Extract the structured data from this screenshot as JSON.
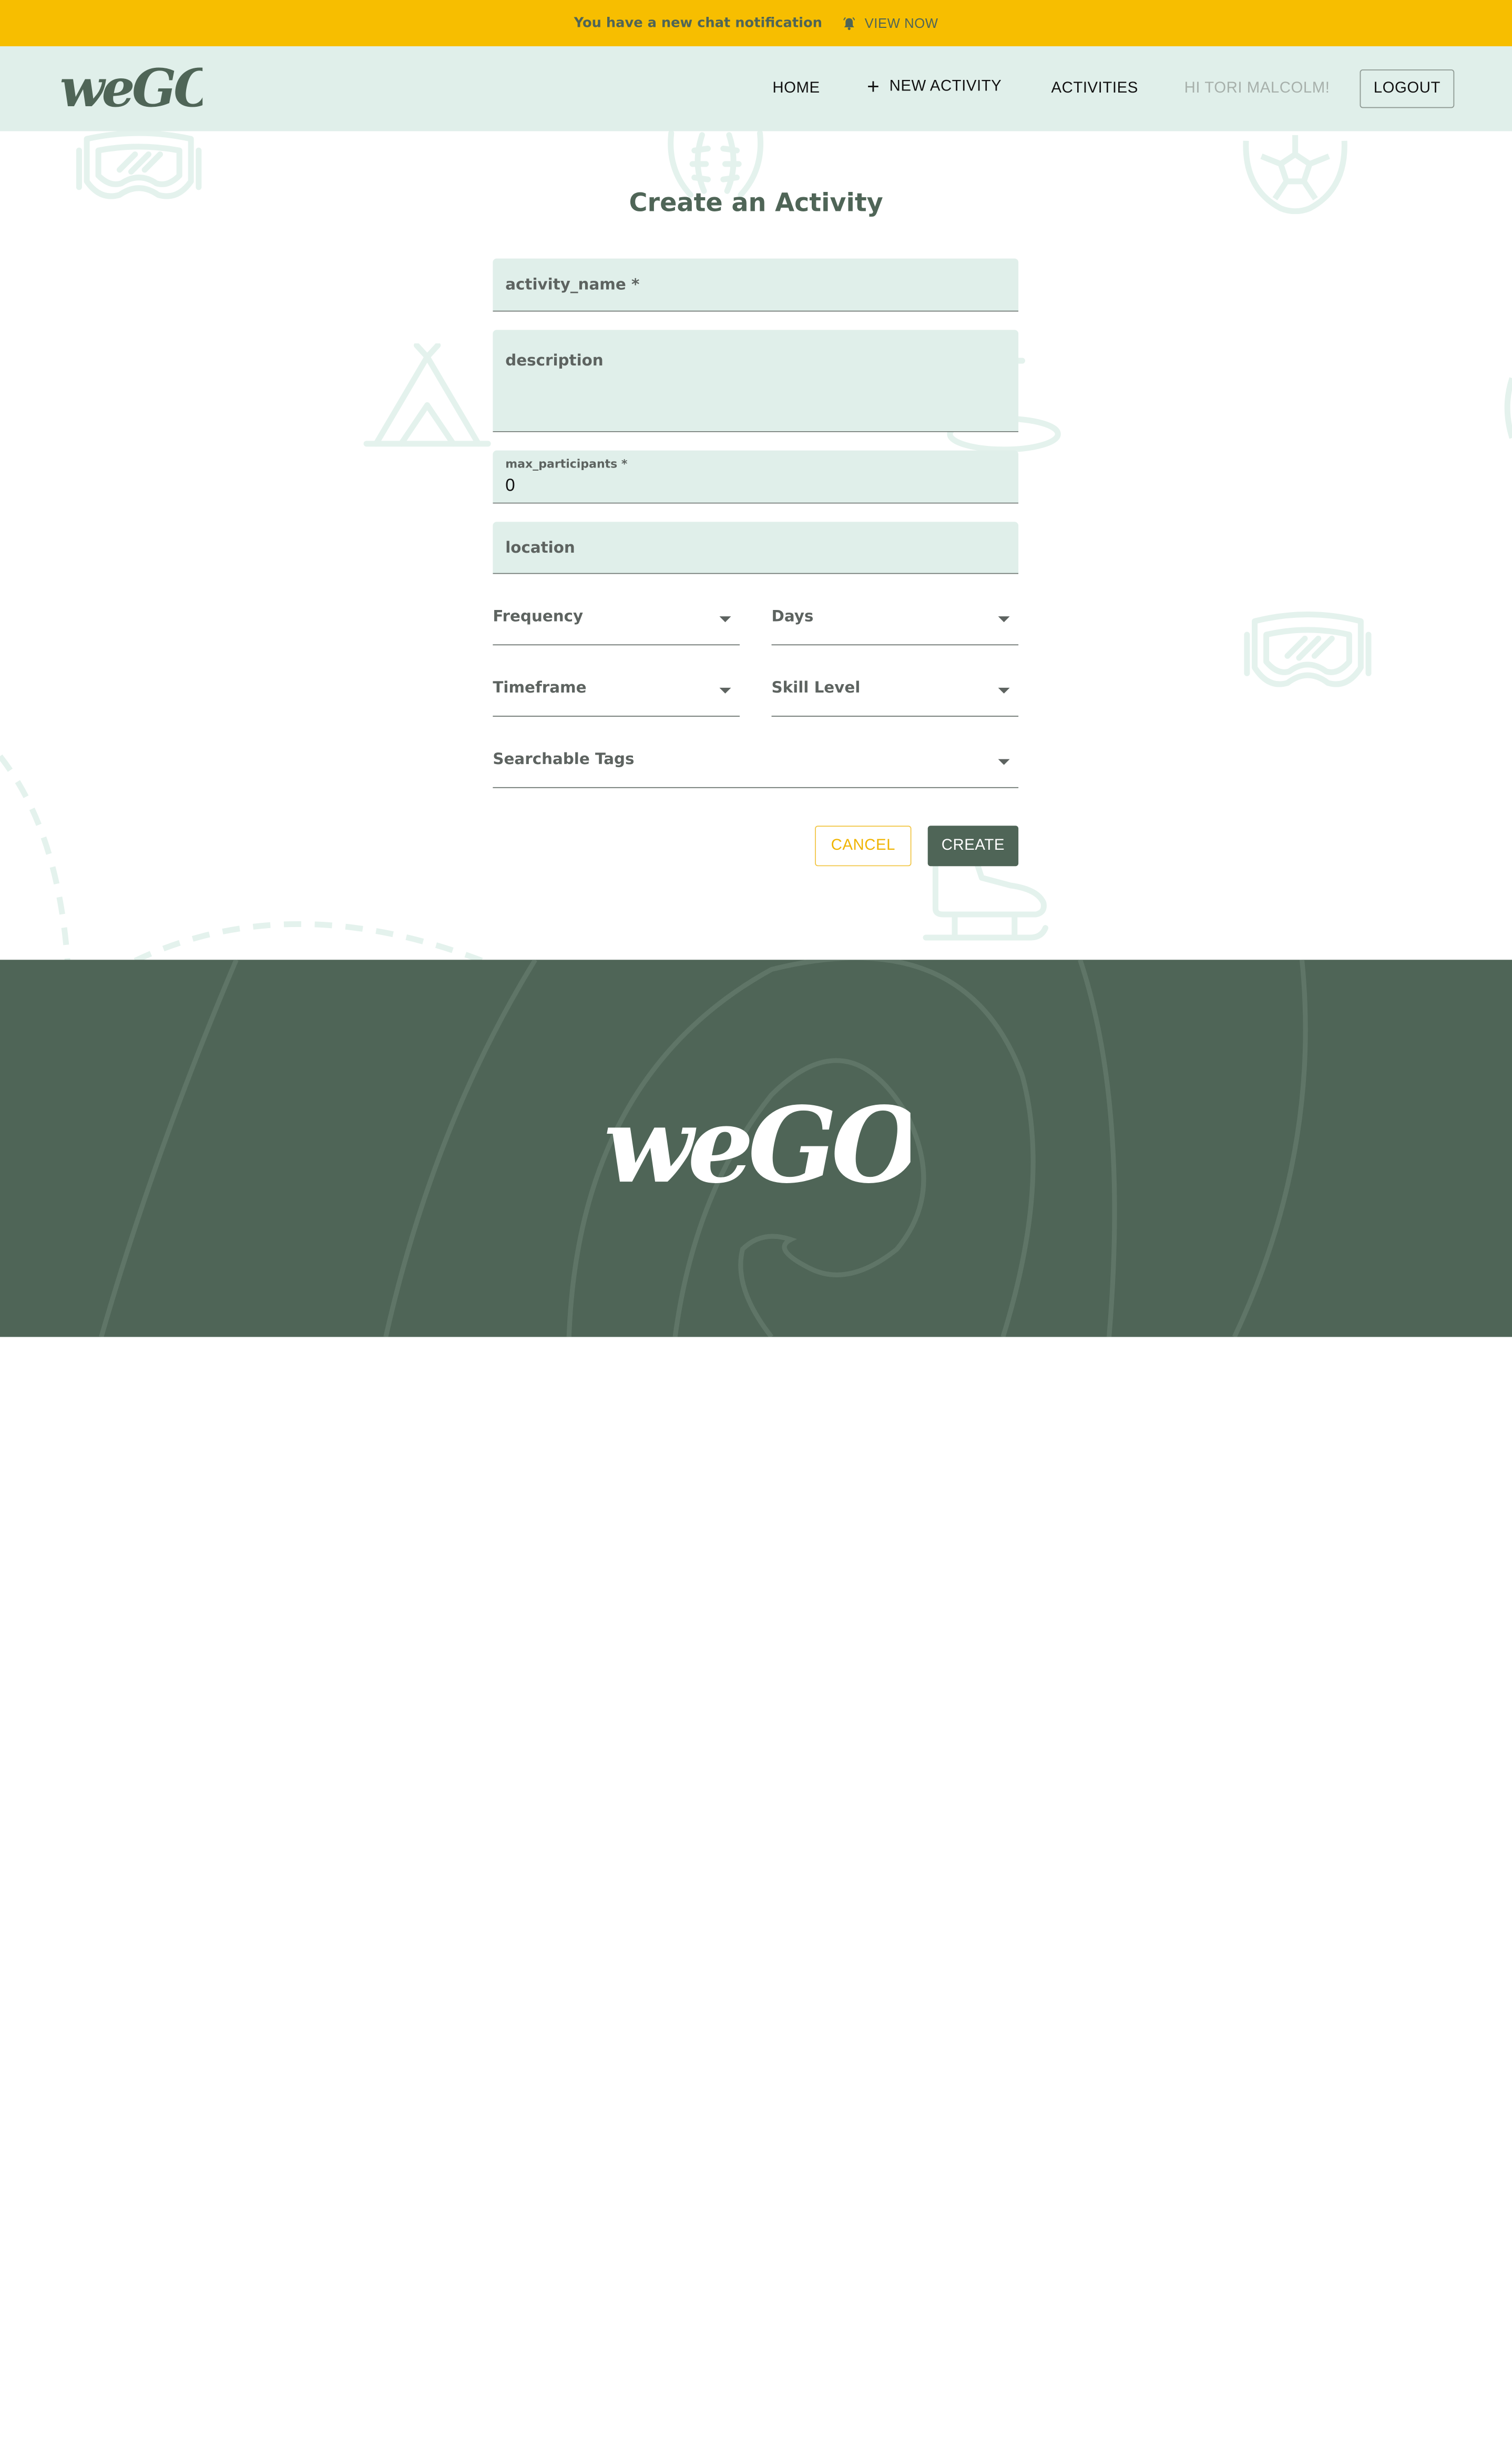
{
  "notification": {
    "message": "You have a new chat notification",
    "link_label": "VIEW NOW",
    "icon": "bell-icon"
  },
  "header": {
    "logo_text": "weGO",
    "nav": {
      "home": "HOME",
      "new_activity": "NEW ACTIVITY",
      "activities": "ACTIVITIES",
      "greeting": "HI TORI MALCOLM!",
      "logout": "LOGOUT"
    }
  },
  "form": {
    "title": "Create an Activity",
    "activity_name_label": "activity_name *",
    "description_label": "description",
    "max_participants_label": "max_participants *",
    "max_participants_value": "0",
    "location_label": "location",
    "frequency_label": "Frequency",
    "days_label": "Days",
    "timeframe_label": "Timeframe",
    "skill_level_label": "Skill Level",
    "tags_label": "Searchable Tags",
    "cancel_label": "CANCEL",
    "create_label": "CREATE"
  },
  "footer": {
    "logo_text": "weGO"
  },
  "colors": {
    "brand_green": "#4f6557",
    "mint": "#e0efea",
    "accent_yellow": "#f7be00",
    "deco_line": "#e7f3ef"
  }
}
